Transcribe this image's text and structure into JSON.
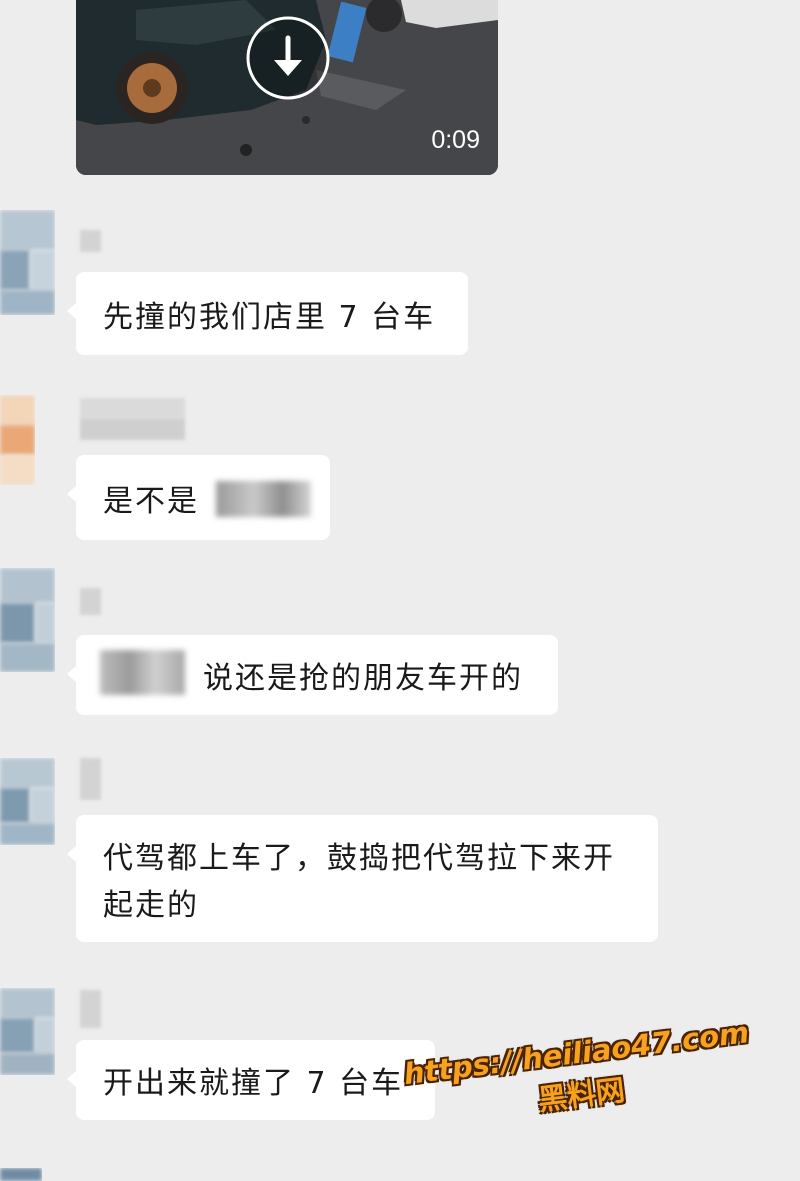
{
  "video": {
    "duration": "0:09",
    "icon": "download-icon"
  },
  "messages": [
    {
      "text": "先撞的我们店里 7 台车"
    },
    {
      "text": "是不是"
    },
    {
      "text": "说还是抢的朋友车开的"
    },
    {
      "text": "代驾都上车了，鼓捣把代驾拉下来开起走的"
    },
    {
      "text": "开出来就撞了 7 台车"
    }
  ],
  "watermark": {
    "url": "https://heiliao47.com",
    "site": "黑料网"
  },
  "colors": {
    "background": "#ededed",
    "bubble": "#ffffff",
    "text": "#1a1a1a",
    "watermark": "#f6a21e"
  }
}
